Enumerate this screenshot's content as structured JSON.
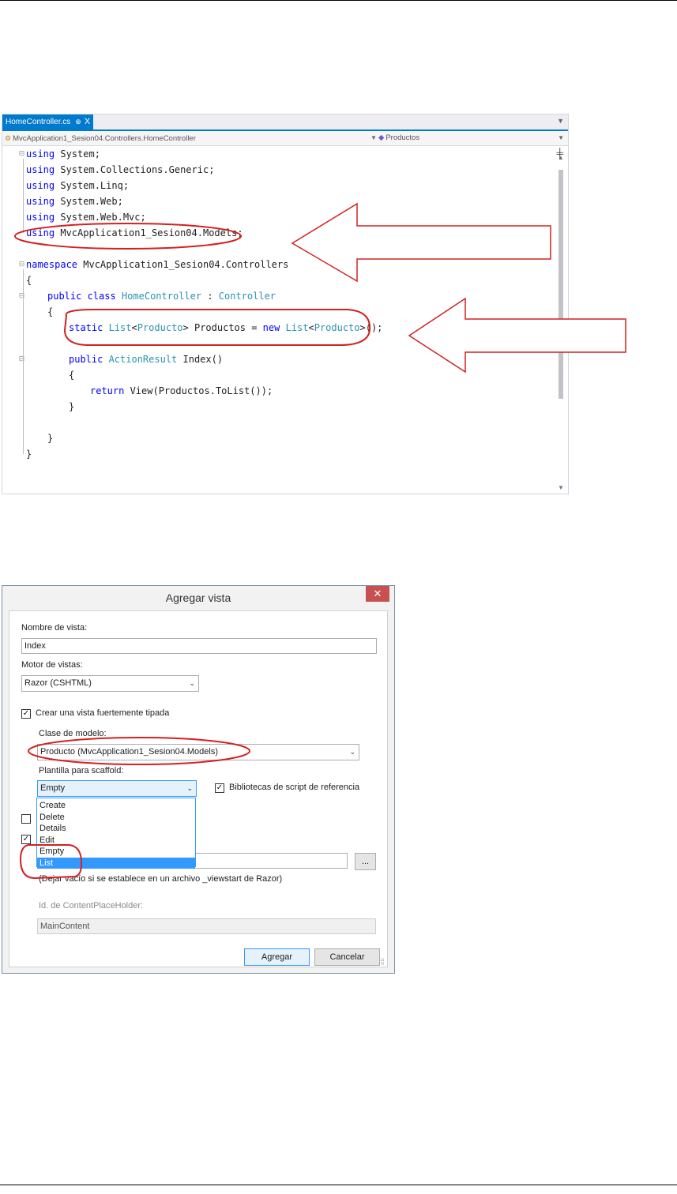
{
  "editor": {
    "tab_label": "HomeController.cs",
    "tab_pin": "⊕",
    "tab_close": "X",
    "nav_left": "MvcApplication1_Sesion04.Controllers.HomeController",
    "nav_right": "Productos",
    "code_lines": [
      {
        "indent": 0,
        "tokens": [
          [
            "kw",
            "using"
          ],
          [
            "",
            "System;"
          ]
        ]
      },
      {
        "indent": 0,
        "tokens": [
          [
            "kw",
            "using"
          ],
          [
            "",
            "System.Collections.Generic;"
          ]
        ]
      },
      {
        "indent": 0,
        "tokens": [
          [
            "kw",
            "using"
          ],
          [
            "",
            "System.Linq;"
          ]
        ]
      },
      {
        "indent": 0,
        "tokens": [
          [
            "kw",
            "using"
          ],
          [
            "",
            "System.Web;"
          ]
        ]
      },
      {
        "indent": 0,
        "tokens": [
          [
            "kw",
            "using"
          ],
          [
            "",
            "System.Web.Mvc;"
          ]
        ]
      },
      {
        "indent": 0,
        "tokens": [
          [
            "kw",
            "using"
          ],
          [
            "",
            "MvcApplication1_Sesion04.Models;"
          ]
        ]
      },
      {
        "indent": 0,
        "tokens": []
      },
      {
        "indent": 0,
        "tokens": [
          [
            "kw",
            "namespace"
          ],
          [
            "",
            "MvcApplication1_Sesion04.Controllers"
          ]
        ]
      },
      {
        "indent": 0,
        "tokens": [
          [
            "",
            "{"
          ]
        ]
      },
      {
        "indent": 1,
        "tokens": [
          [
            "kw",
            "public"
          ],
          [
            "kw",
            "class"
          ],
          [
            "ty",
            "HomeController"
          ],
          [
            "",
            ":"
          ],
          [
            "ty",
            "Controller"
          ]
        ]
      },
      {
        "indent": 1,
        "tokens": [
          [
            "",
            "{"
          ]
        ]
      },
      {
        "indent": 2,
        "tokens": [
          [
            "kw",
            "static"
          ],
          [
            "ty",
            "List"
          ],
          [
            "",
            "<"
          ],
          [
            "ty",
            "Producto"
          ],
          [
            "",
            "> Productos ="
          ],
          [
            "kw",
            "new"
          ],
          [
            "ty",
            "List"
          ],
          [
            "",
            "<"
          ],
          [
            "ty",
            "Producto"
          ],
          [
            "",
            ">();"
          ]
        ]
      },
      {
        "indent": 0,
        "tokens": []
      },
      {
        "indent": 2,
        "tokens": [
          [
            "kw",
            "public"
          ],
          [
            "ty",
            "ActionResult"
          ],
          [
            "",
            "Index()"
          ]
        ]
      },
      {
        "indent": 2,
        "tokens": [
          [
            "",
            "{"
          ]
        ]
      },
      {
        "indent": 3,
        "tokens": [
          [
            "kw",
            "return"
          ],
          [
            "",
            "View(Productos.ToList());"
          ]
        ]
      },
      {
        "indent": 2,
        "tokens": [
          [
            "",
            "}"
          ]
        ]
      },
      {
        "indent": 0,
        "tokens": []
      },
      {
        "indent": 1,
        "tokens": [
          [
            "",
            "}"
          ]
        ]
      },
      {
        "indent": 0,
        "tokens": [
          [
            "",
            "}"
          ]
        ]
      }
    ]
  },
  "dialog": {
    "title": "Agregar vista",
    "close": "✕",
    "view_name_label": "Nombre de vista:",
    "view_name_value": "Index",
    "engine_label": "Motor de vistas:",
    "engine_value": "Razor (CSHTML)",
    "strongly_typed_label": "Crear una vista fuertemente tipada",
    "strongly_typed_checked": true,
    "model_class_label": "Clase de modelo:",
    "model_class_value": "Producto (MvcApplication1_Sesion04.Models)",
    "scaffold_label": "Plantilla para scaffold:",
    "scaffold_value": "Empty",
    "scaffold_options": [
      "Create",
      "Delete",
      "Details",
      "Edit",
      "Empty",
      "List"
    ],
    "scaffold_highlighted": "List",
    "script_libs_label": "Bibliotecas de script de referencia",
    "script_libs_checked": true,
    "layout_hint": "(Dejar vacío si se establece en un archivo _viewstart de Razor)",
    "browse_label": "...",
    "placeholder_label": "Id. de ContentPlaceHolder:",
    "placeholder_value": "MainContent",
    "add_button": "Agregar",
    "cancel_button": "Cancelar"
  }
}
